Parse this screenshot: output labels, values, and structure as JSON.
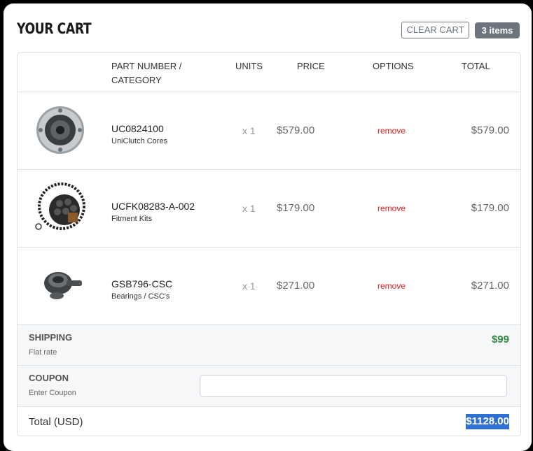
{
  "cart": {
    "title": "YOUR CART",
    "clear_label": "CLEAR CART",
    "item_count": "3 items"
  },
  "columns": {
    "part": "PART NUMBER /",
    "category": "CATEGORY",
    "units": "UNITS",
    "price": "PRICE",
    "options": "OPTIONS",
    "total": "TOTAL"
  },
  "items": [
    {
      "part": "UC0824100",
      "category": "UniClutch Cores",
      "units": "x 1",
      "price": "$579.00",
      "option": "remove",
      "total": "$579.00",
      "icon": "clutch-core-icon"
    },
    {
      "part": "UCFK08283-A-002",
      "category": "Fitment Kits",
      "units": "x 1",
      "price": "$179.00",
      "option": "remove",
      "total": "$179.00",
      "icon": "fitment-kit-icon"
    },
    {
      "part": "GSB796-CSC",
      "category": "Bearings / CSC's",
      "units": "x 1",
      "price": "$271.00",
      "option": "remove",
      "total": "$271.00",
      "icon": "bearing-icon"
    }
  ],
  "shipping": {
    "label": "SHIPPING",
    "sub": "Flat rate",
    "value": "$99"
  },
  "coupon": {
    "label": "COUPON",
    "sub": "Enter Coupon",
    "value": "",
    "placeholder": ""
  },
  "summary": {
    "label": "Total (USD)",
    "value": "$1128.00"
  },
  "colors": {
    "accent": "#2f6fd1",
    "remove": "#dc1c1c",
    "shipping": "#2e8b43",
    "badge": "#6c757d"
  }
}
